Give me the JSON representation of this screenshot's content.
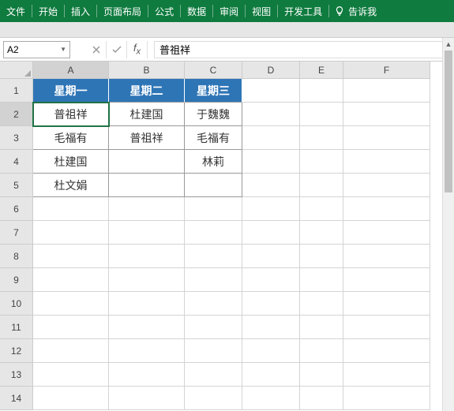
{
  "ribbon": {
    "tabs": [
      "文件",
      "开始",
      "插入",
      "页面布局",
      "公式",
      "数据",
      "审阅",
      "视图",
      "开发工具"
    ],
    "tellme": "告诉我"
  },
  "namebox": {
    "value": "A2"
  },
  "formula_bar": {
    "value": "普祖祥"
  },
  "columns": [
    "A",
    "B",
    "C",
    "D",
    "E",
    "F"
  ],
  "rows": [
    "1",
    "2",
    "3",
    "4",
    "5",
    "6",
    "7",
    "8",
    "9",
    "10",
    "11",
    "12",
    "13",
    "14"
  ],
  "active_cell": "A2",
  "chart_data": {
    "type": "table",
    "headers": [
      "星期一",
      "星期二",
      "星期三"
    ],
    "data": [
      [
        "普祖祥",
        "杜建国",
        "于魏魏"
      ],
      [
        "毛福有",
        "普祖祥",
        "毛福有"
      ],
      [
        "杜建国",
        "",
        "林莉"
      ],
      [
        "杜文娟",
        "",
        ""
      ]
    ]
  }
}
